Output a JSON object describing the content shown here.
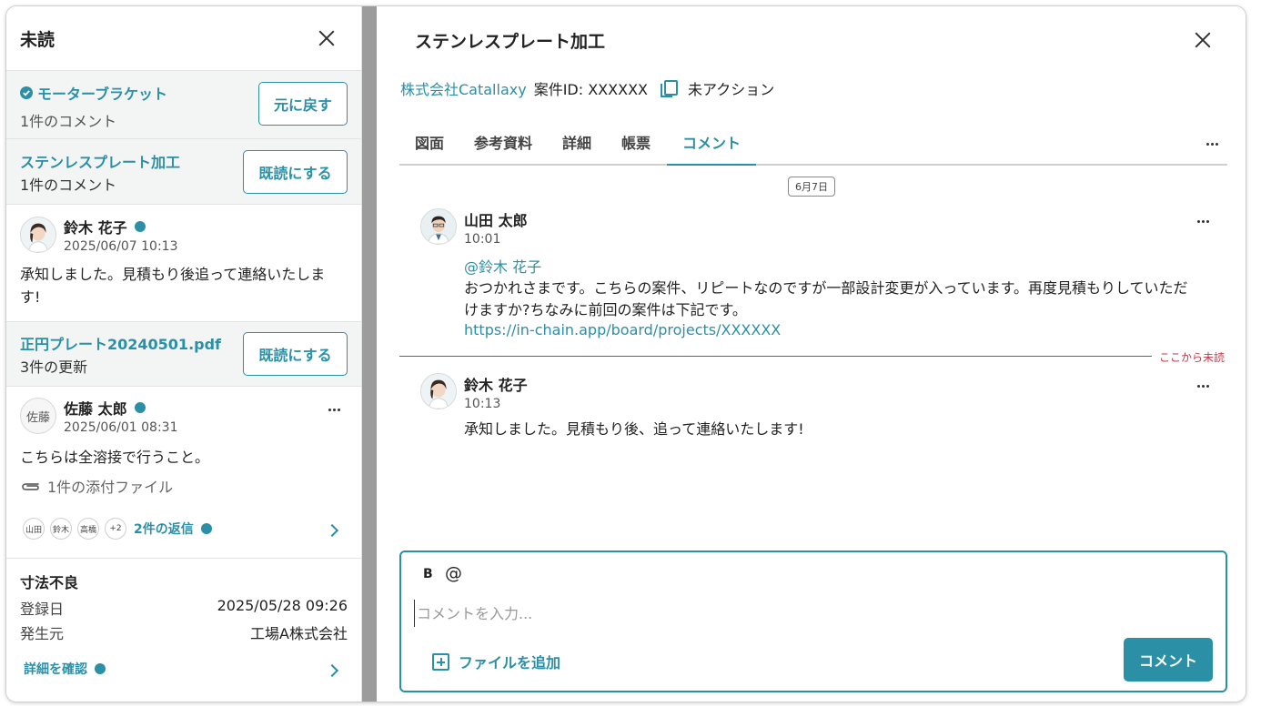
{
  "colors": {
    "accent": "#2b8fa6",
    "unread": "#c0394b"
  },
  "left": {
    "title": "未読",
    "notifications": [
      {
        "title": "モーターブラケット",
        "sub": "1件のコメント",
        "button": "元に戻す",
        "icon": "check-circle-icon"
      },
      {
        "title": "ステンレスプレート加工",
        "sub": "1件のコメント",
        "button": "既読にする"
      }
    ],
    "comment1": {
      "name": "鈴木 花子",
      "time": "2025/06/07 10:13",
      "text": "承知しました。見積もり後追って連絡いたします!"
    },
    "file_notice": {
      "title": "正円プレート20240501.pdf",
      "sub": "3件の更新",
      "button": "既読にする"
    },
    "comment2": {
      "avatar": "佐藤",
      "name": "佐藤 太郎",
      "time": "2025/06/01 08:31",
      "text": "こちらは全溶接で行うこと。",
      "attachment": "1件の添付ファイル",
      "replier_avatars": [
        "山田",
        "鈴木",
        "高橋",
        "+2"
      ],
      "replies": "2件の返信"
    },
    "issue": {
      "title": "寸法不良",
      "rows": [
        {
          "label": "登録日",
          "value": "2025/05/28 09:26"
        },
        {
          "label": "発生元",
          "value": "工場A株式会社"
        }
      ],
      "link": "詳細を確認"
    }
  },
  "right": {
    "title": "ステンレスプレート加工",
    "company": "株式会社Catallaxy",
    "case_id": "案件ID: XXXXXX",
    "status": "未アクション",
    "tabs": [
      "図面",
      "参考資料",
      "詳細",
      "帳票",
      "コメント"
    ],
    "active_tab": "コメント",
    "date_chip": "6月7日",
    "messages": [
      {
        "name": "山田 太郎",
        "time": "10:01",
        "mention": "@鈴木 花子",
        "text_line1": "おつかれさまです。こちらの案件、リピートなのですが一部設計変更が入っています。再度見積もりしていただ",
        "text_line2": "けますか?ちなみに前回の案件は下記です。",
        "link": "https://in-chain.app/board/projects/XXXXXX"
      },
      {
        "name": "鈴木 花子",
        "time": "10:13",
        "text": "承知しました。見積もり後、追って連絡いたします!"
      }
    ],
    "unread_label": "ここから未読",
    "composer": {
      "bold": "B",
      "mention": "@",
      "placeholder": "コメントを入力...",
      "add_file": "ファイルを追加",
      "submit": "コメント"
    }
  }
}
